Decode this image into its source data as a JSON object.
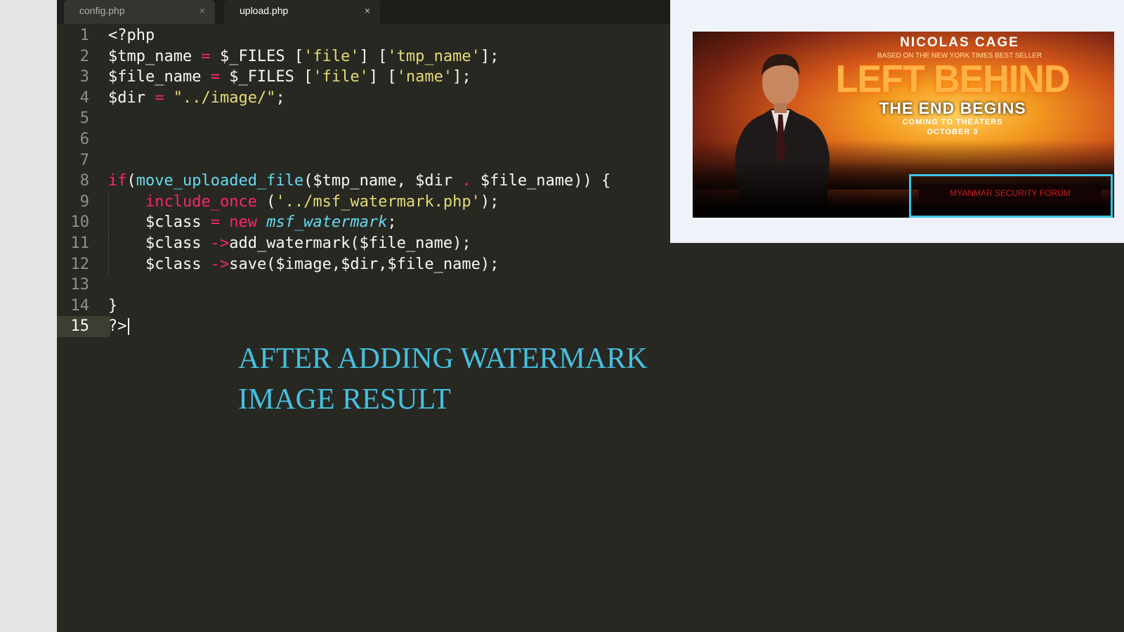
{
  "editor": {
    "tabs": [
      {
        "label": "config.php",
        "active": false,
        "close": "×"
      },
      {
        "label": "upload.php",
        "active": true,
        "close": "×"
      }
    ],
    "current_line": 15,
    "code": [
      {
        "num": "1",
        "tokens": [
          {
            "t": "<?php",
            "c": "v"
          }
        ]
      },
      {
        "num": "2",
        "tokens": [
          {
            "t": "$tmp_name ",
            "c": "v"
          },
          {
            "t": "=",
            "c": "op"
          },
          {
            "t": " $_FILES [",
            "c": "v"
          },
          {
            "t": "'file'",
            "c": "str"
          },
          {
            "t": "] [",
            "c": "v"
          },
          {
            "t": "'tmp_name'",
            "c": "str"
          },
          {
            "t": "];",
            "c": "v"
          }
        ]
      },
      {
        "num": "3",
        "tokens": [
          {
            "t": "$file_name ",
            "c": "v"
          },
          {
            "t": "=",
            "c": "op"
          },
          {
            "t": " $_FILES [",
            "c": "v"
          },
          {
            "t": "'file'",
            "c": "str"
          },
          {
            "t": "] [",
            "c": "v"
          },
          {
            "t": "'name'",
            "c": "str"
          },
          {
            "t": "];",
            "c": "v"
          }
        ]
      },
      {
        "num": "4",
        "tokens": [
          {
            "t": "$dir ",
            "c": "v"
          },
          {
            "t": "=",
            "c": "op"
          },
          {
            "t": " ",
            "c": "v"
          },
          {
            "t": "\"../image/\"",
            "c": "str"
          },
          {
            "t": ";",
            "c": "v"
          }
        ]
      },
      {
        "num": "5",
        "tokens": []
      },
      {
        "num": "6",
        "tokens": []
      },
      {
        "num": "7",
        "tokens": []
      },
      {
        "num": "8",
        "tokens": [
          {
            "t": "if",
            "c": "kw"
          },
          {
            "t": "(",
            "c": "v"
          },
          {
            "t": "move_uploaded_file",
            "c": "fn"
          },
          {
            "t": "($tmp_name, $dir ",
            "c": "v"
          },
          {
            "t": ".",
            "c": "op"
          },
          {
            "t": " $file_name)) {",
            "c": "v"
          }
        ]
      },
      {
        "num": "9",
        "guide": true,
        "tokens": [
          {
            "t": "    ",
            "c": "v"
          },
          {
            "t": "include_once",
            "c": "kw"
          },
          {
            "t": " (",
            "c": "v"
          },
          {
            "t": "'../msf_watermark.php'",
            "c": "str"
          },
          {
            "t": ");",
            "c": "v"
          }
        ]
      },
      {
        "num": "10",
        "guide": true,
        "tokens": [
          {
            "t": "    $class ",
            "c": "v"
          },
          {
            "t": "=",
            "c": "op"
          },
          {
            "t": " ",
            "c": "v"
          },
          {
            "t": "new",
            "c": "kw"
          },
          {
            "t": " ",
            "c": "v"
          },
          {
            "t": "msf_watermark",
            "c": "cls"
          },
          {
            "t": ";",
            "c": "v"
          }
        ]
      },
      {
        "num": "11",
        "guide": true,
        "tokens": [
          {
            "t": "    $class ",
            "c": "v"
          },
          {
            "t": "->",
            "c": "op"
          },
          {
            "t": "add_watermark($file_name);",
            "c": "v"
          }
        ]
      },
      {
        "num": "12",
        "guide": true,
        "tokens": [
          {
            "t": "    $class ",
            "c": "v"
          },
          {
            "t": "->",
            "c": "op"
          },
          {
            "t": "save($image,$dir,$file_name);",
            "c": "v"
          }
        ]
      },
      {
        "num": "13",
        "tokens": []
      },
      {
        "num": "14",
        "tokens": [
          {
            "t": "}",
            "c": "v"
          }
        ]
      },
      {
        "num": "15",
        "tokens": [
          {
            "t": "?>",
            "c": "v"
          }
        ],
        "caret": true
      }
    ]
  },
  "caption": {
    "line1": "AFTER ADDING WATERMARK",
    "line2": "IMAGE RESULT",
    "color": "#46c0e0"
  },
  "banner": {
    "actor": "NICOLAS  CAGE",
    "tagline": "BASED ON THE NEW YORK TIMES BEST SELLER",
    "title": "LEFT BEHIND",
    "subtitle": "THE END BEGINS",
    "coming": "COMING TO THEATERS",
    "date": "OCTOBER 3",
    "watermark": "MYANMAR SECURITY FORUM",
    "highlight_color": "#3cc4e6"
  }
}
